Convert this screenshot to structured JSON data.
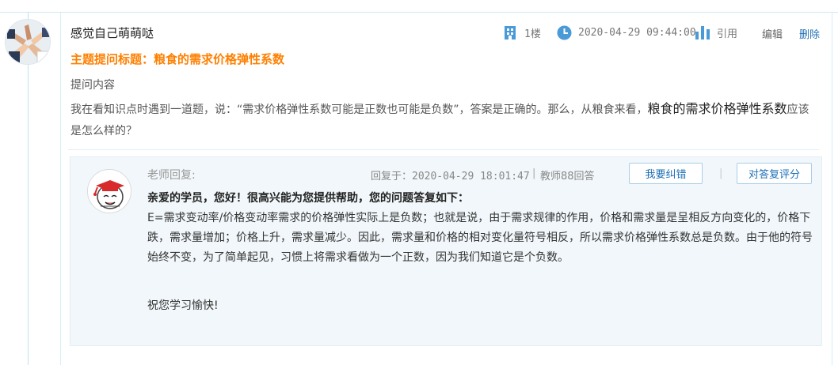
{
  "post": {
    "username": "感觉自己萌萌哒",
    "floor": "1楼",
    "datetime": "2020-04-29 09:44:00",
    "quote_label": "引用",
    "edit_label": "编辑",
    "delete_label": "删除",
    "topic_title": "主题提问标题：粮食的需求价格弹性系数",
    "question_label": "提问内容",
    "question_text_a": "我在看知识点时遇到一道题，说：“需求价格弹性系数可能是正数也可能是负数”，答案是正确的。那么，从粮食来看，",
    "question_text_emph": "粮食的需求价格弹性系数",
    "question_text_b": "应该是怎么样的？"
  },
  "reply": {
    "teacher_label": "老师回复:",
    "reply_time": "回复于：2020-04-29 18:01:47",
    "separator": "|",
    "answer_count": "教师88回答",
    "correct_button": "我要纠错",
    "rate_button": "对答复评分",
    "greeting": "亲爱的学员，您好！很高兴能为您提供帮助，您的问题答复如下：",
    "answer": "E=需求变动率/价格变动率需求的价格弹性实际上是负数；也就是说，由于需求规律的作用，价格和需求量是呈相反方向变化的，价格下跌，需求量增加；价格上升，需求量减少。因此，需求量和价格的相对变化量符号相反，所以需求价格弹性系数总是负数。由于他的符号始终不变，为了简单起见，习惯上将需求看做为一个正数，因为我们知道它是个负数。",
    "signoff": "祝您学习愉快!"
  },
  "colors": {
    "accent_blue": "#1e6fb7",
    "icon_blue": "#4a9ad8",
    "title_orange": "#ff7f00",
    "reply_bg": "#f1f7fa"
  },
  "icons": [
    "building-icon",
    "clock-icon",
    "bar-chart-icon"
  ]
}
